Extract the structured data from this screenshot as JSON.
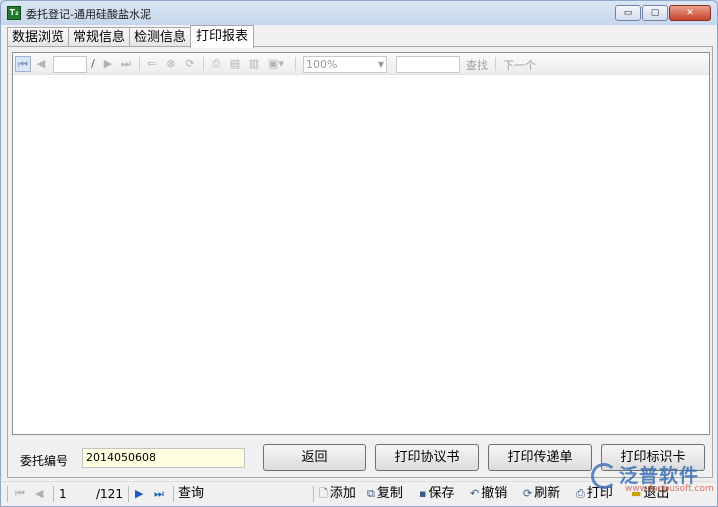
{
  "window": {
    "title": "委托登记-通用硅酸盐水泥",
    "icon_text": "T₂",
    "controls": {
      "minimize": "▭",
      "maximize": "▢",
      "close": "✕"
    }
  },
  "tabs": [
    {
      "label": "数据浏览"
    },
    {
      "label": "常规信息"
    },
    {
      "label": "检测信息"
    },
    {
      "label": "打印报表",
      "active": true
    }
  ],
  "report_toolbar": {
    "first_icon": "⏮",
    "prev_icon": "◀",
    "page_value": "",
    "page_sep": "/",
    "next_icon": "▶",
    "last_icon": "⏭",
    "back_icon": "⇐",
    "stop_icon": "⊗",
    "refresh_icon": "⟳",
    "print_icon": "⎙",
    "layout_icon": "▤",
    "pagesetup_icon": "▥",
    "export_icon": "▣▾",
    "zoom": "100%",
    "find_value": "",
    "find_label": "查找",
    "next_label": "下一个"
  },
  "form": {
    "entrust_label": "委托编号",
    "entrust_value": "2014050608"
  },
  "buttons": {
    "back": "返回",
    "print_agreement": "打印协议书",
    "print_transfer": "打印传递单",
    "print_id_card": "打印标识卡"
  },
  "statusbar": {
    "first_icon": "⏮",
    "prev_icon": "◀",
    "current_page": "1",
    "total_pages": "/121",
    "next_icon": "▶",
    "last_icon": "⏭",
    "query": "查询",
    "add": "添加",
    "copy": "复制",
    "save": "保存",
    "undo": "撤销",
    "refresh": "刷新",
    "print": "打印",
    "exit": "退出",
    "icons": {
      "add": "🗋",
      "copy": "⧉",
      "save": "▪",
      "undo": "↶",
      "refresh": "⟳",
      "print": "⎙",
      "exit": "▬"
    }
  },
  "watermark": {
    "brand": "泛普软件",
    "url": "www.fanpusoft.com"
  }
}
